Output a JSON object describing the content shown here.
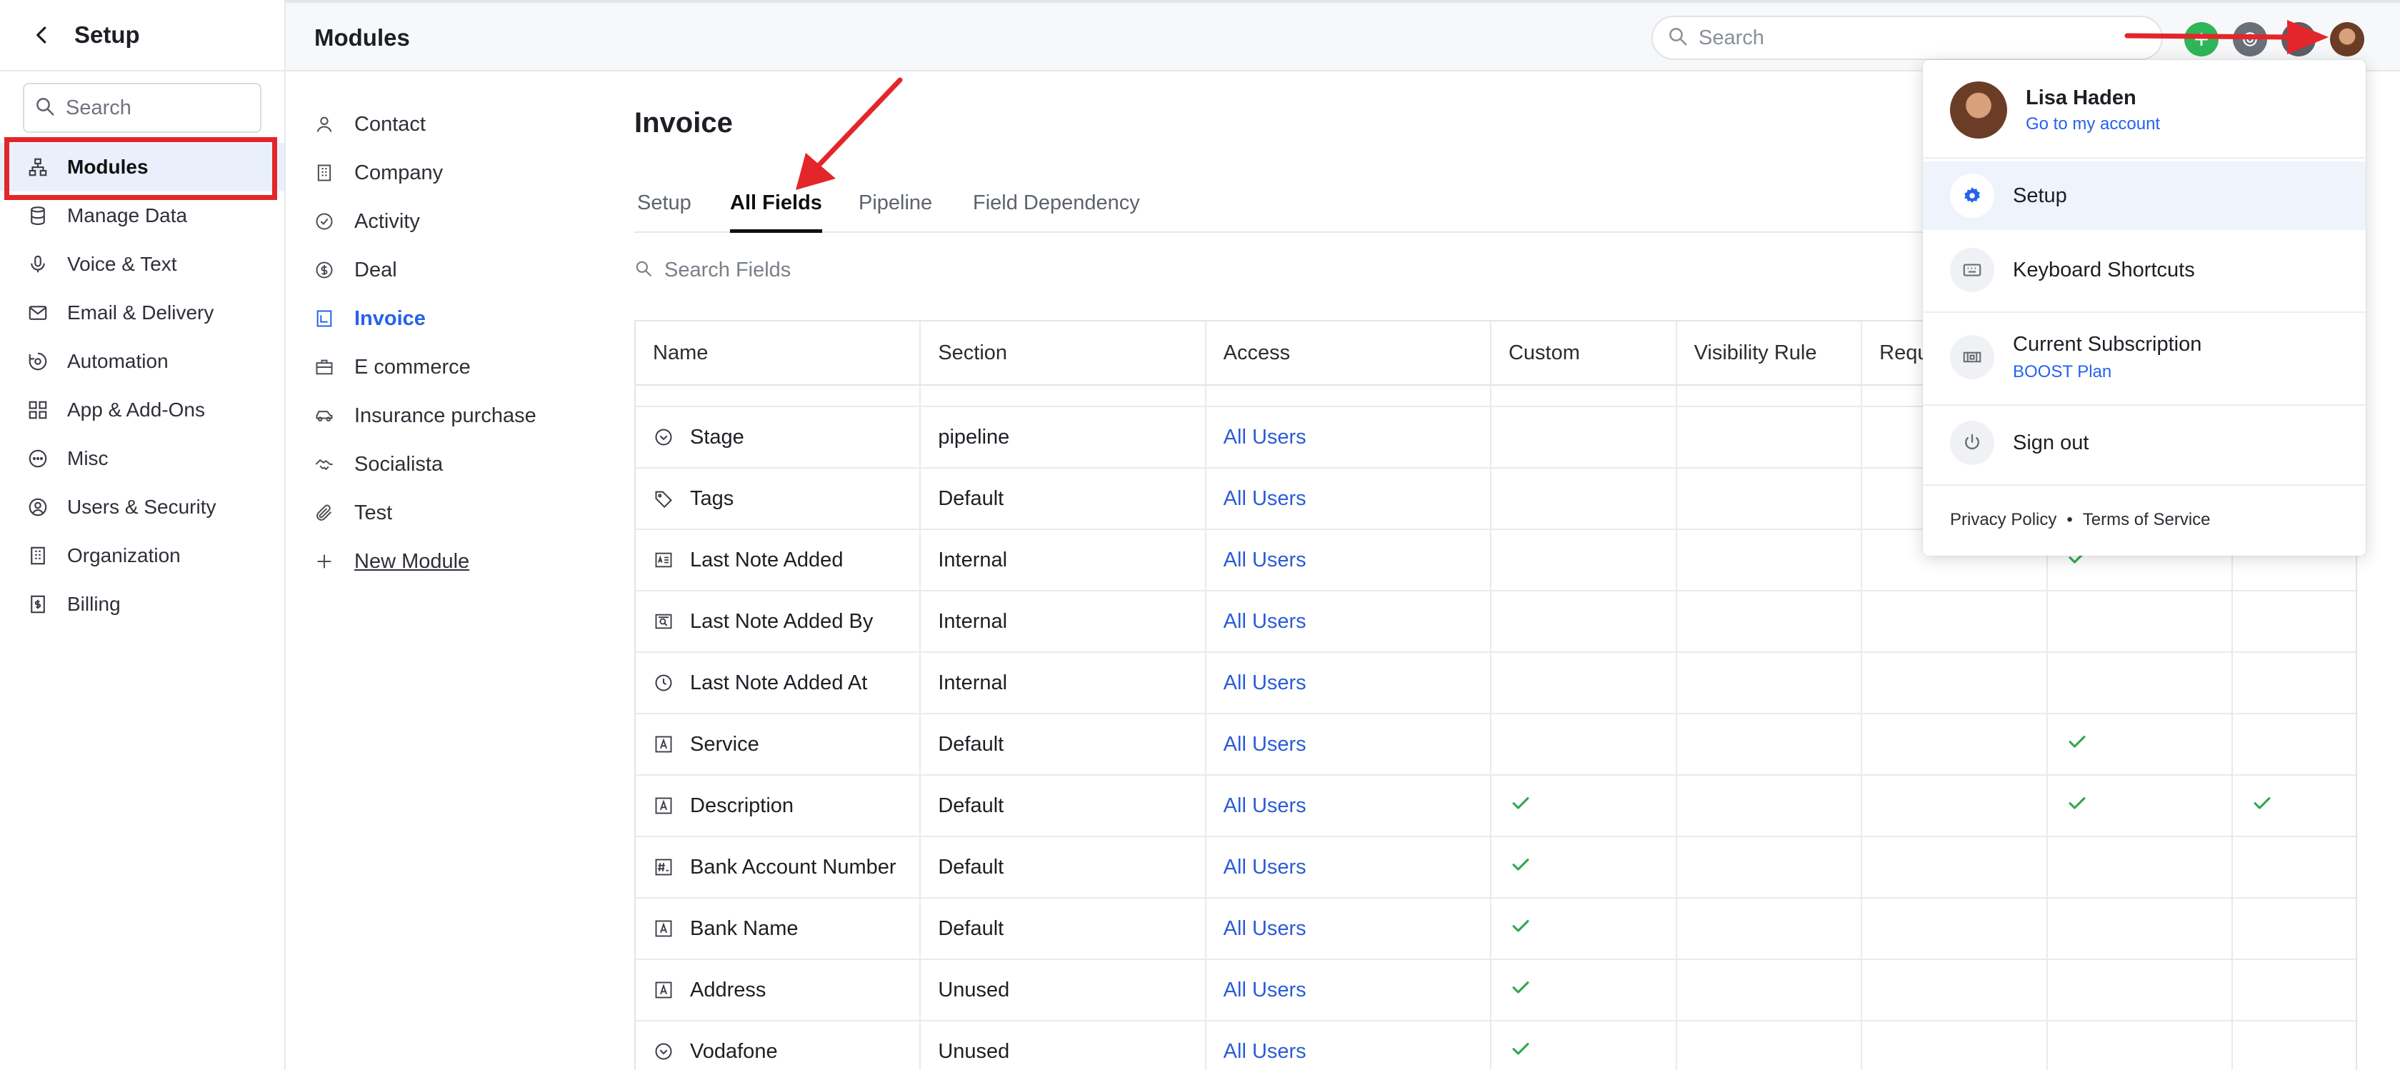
{
  "sidebar": {
    "title": "Setup",
    "search_placeholder": "Search",
    "items": [
      {
        "label": "Modules",
        "icon": "sitemap-icon"
      },
      {
        "label": "Manage Data",
        "icon": "database-icon"
      },
      {
        "label": "Voice & Text",
        "icon": "microphone-icon"
      },
      {
        "label": "Email & Delivery",
        "icon": "envelope-icon"
      },
      {
        "label": "Automation",
        "icon": "automation-icon"
      },
      {
        "label": "App & Add-Ons",
        "icon": "apps-grid-icon"
      },
      {
        "label": "Misc",
        "icon": "ellipsis-icon"
      },
      {
        "label": "Users & Security",
        "icon": "user-circle-icon"
      },
      {
        "label": "Organization",
        "icon": "building-icon"
      },
      {
        "label": "Billing",
        "icon": "billing-icon"
      }
    ]
  },
  "topbar": {
    "title": "Modules",
    "search_placeholder": "Search"
  },
  "modules": {
    "items": [
      {
        "label": "Contact",
        "icon": "person-icon"
      },
      {
        "label": "Company",
        "icon": "building-icon"
      },
      {
        "label": "Activity",
        "icon": "check-circle-icon"
      },
      {
        "label": "Deal",
        "icon": "dollar-circle-icon"
      },
      {
        "label": "Invoice",
        "icon": "invoice-icon"
      },
      {
        "label": "E commerce",
        "icon": "briefcase-icon"
      },
      {
        "label": "Insurance purchase",
        "icon": "car-icon"
      },
      {
        "label": "Socialista",
        "icon": "handshake-icon"
      },
      {
        "label": "Test",
        "icon": "paperclip-icon"
      },
      {
        "label": "New Module",
        "icon": "plus-icon"
      }
    ]
  },
  "main": {
    "title": "Invoice",
    "tabs": [
      "Setup",
      "All Fields",
      "Pipeline",
      "Field Dependency"
    ],
    "field_search_placeholder": "Search Fields",
    "columns": [
      "Name",
      "Section",
      "Access",
      "Custom",
      "Visibility Rule",
      "Requ",
      "",
      ""
    ],
    "rows": [
      {
        "name": "Stage",
        "icon": "chevron-circle-icon",
        "section": "pipeline",
        "access": "All Users",
        "custom": false,
        "c7": false,
        "c8": false
      },
      {
        "name": "Tags",
        "icon": "tag-icon",
        "section": "Default",
        "access": "All Users",
        "custom": false,
        "c7": false,
        "c8": false
      },
      {
        "name": "Last Note Added",
        "icon": "note-text-icon",
        "section": "Internal",
        "access": "All Users",
        "custom": false,
        "c7": true,
        "c8": false
      },
      {
        "name": "Last Note Added By",
        "icon": "user-search-icon",
        "section": "Internal",
        "access": "All Users",
        "custom": false,
        "c7": false,
        "c8": false
      },
      {
        "name": "Last Note Added At",
        "icon": "clock-icon",
        "section": "Internal",
        "access": "All Users",
        "custom": false,
        "c7": false,
        "c8": false
      },
      {
        "name": "Service",
        "icon": "text-field-icon",
        "section": "Default",
        "access": "All Users",
        "custom": false,
        "c7": true,
        "c8": false
      },
      {
        "name": "Description",
        "icon": "text-field-icon",
        "section": "Default",
        "access": "All Users",
        "custom": true,
        "c7": true,
        "c8": true
      },
      {
        "name": "Bank Account Number",
        "icon": "number-field-icon",
        "section": "Default",
        "access": "All Users",
        "custom": true,
        "c7": false,
        "c8": false
      },
      {
        "name": "Bank Name",
        "icon": "text-field-icon",
        "section": "Default",
        "access": "All Users",
        "custom": true,
        "c7": false,
        "c8": false
      },
      {
        "name": "Address",
        "icon": "text-field-icon",
        "section": "Unused",
        "access": "All Users",
        "custom": true,
        "c7": false,
        "c8": false
      },
      {
        "name": "Vodafone",
        "icon": "chevron-circle-icon",
        "section": "Unused",
        "access": "All Users",
        "custom": true,
        "c7": false,
        "c8": false
      }
    ]
  },
  "account_menu": {
    "user_name": "Lisa Haden",
    "account_link": "Go to my account",
    "items": [
      {
        "label": "Setup",
        "icon": "gear-icon"
      },
      {
        "label": "Keyboard Shortcuts",
        "icon": "keyboard-icon"
      },
      {
        "label": "Current Subscription",
        "sub": "BOOST Plan",
        "icon": "subscription-icon"
      },
      {
        "label": "Sign out",
        "icon": "power-icon"
      }
    ],
    "footer": {
      "privacy": "Privacy Policy",
      "separator": "•",
      "terms": "Terms of Service"
    }
  },
  "colors": {
    "accent": "#2563eb",
    "check": "#2fa84f",
    "annotation": "#e3262a",
    "add_button": "#2fb55a"
  }
}
